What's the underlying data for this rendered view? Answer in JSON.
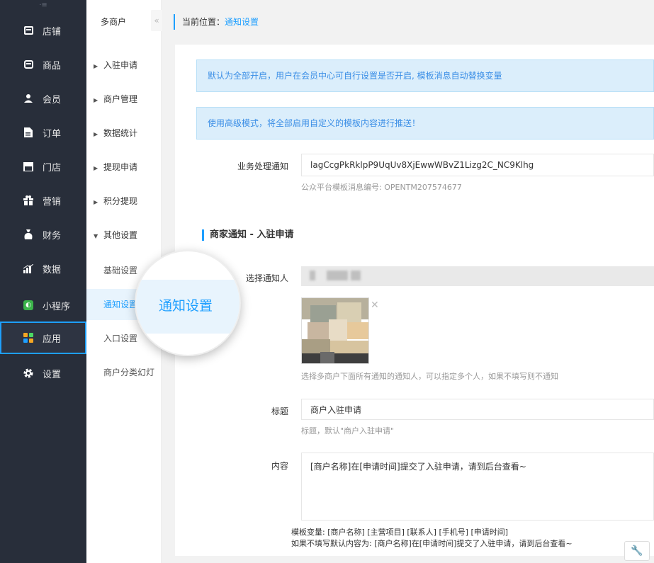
{
  "sidebar": {
    "items": [
      {
        "label": "店铺",
        "icon": "store-icon"
      },
      {
        "label": "商品",
        "icon": "goods-icon"
      },
      {
        "label": "会员",
        "icon": "user-icon"
      },
      {
        "label": "订单",
        "icon": "order-icon"
      },
      {
        "label": "门店",
        "icon": "shop-icon"
      },
      {
        "label": "营销",
        "icon": "gift-icon"
      },
      {
        "label": "财务",
        "icon": "money-bag-icon"
      },
      {
        "label": "数据",
        "icon": "bar-chart-icon"
      },
      {
        "label": "小程序",
        "icon": "mini-program-icon"
      },
      {
        "label": "应用",
        "icon": "apps-icon"
      },
      {
        "label": "设置",
        "icon": "gear-icon"
      }
    ]
  },
  "submenu": {
    "title": "多商户",
    "items": [
      "入驻申请",
      "商户管理",
      "数据统计",
      "提现申请",
      "积分提现",
      "其他设置"
    ],
    "subitems": [
      "基础设置",
      "通知设置",
      "入口设置",
      "商户分类幻灯"
    ]
  },
  "breadcrumb": {
    "prefix": "当前位置：",
    "current": "通知设置"
  },
  "tips": {
    "tip1": "默认为全部开启，用户在会员中心可自行设置是否开启, 模板消息自动替换变量",
    "tip2": "使用高级模式，将全部启用自定义的模板内容进行推送！"
  },
  "business_notice": {
    "label": "业务处理通知",
    "value": "lagCcgPkRklpP9UqUv8XjEwwWBvZ1Lizg2C_NC9Klhg",
    "help": "公众平台模板消息编号: OPENTM207574677"
  },
  "section": {
    "title": "商家通知 - 入驻申请"
  },
  "notify_person": {
    "label": "选择通知人",
    "help": "选择多商户下面所有通知的通知人，可以指定多个人，如果不填写则不通知"
  },
  "title_field": {
    "label": "标题",
    "value": "商户入驻申请",
    "help": "标题，默认\"商户入驻申请\""
  },
  "content_field": {
    "label": "内容",
    "value": "[商户名称]在[申请时间]提交了入驻申请，请到后台查看~",
    "vars": "模板变量: [商户名称] [主营项目] [联系人] [手机号] [申请时间]",
    "default": "如果不填写默认内容为: [商户名称]在[申请时间]提交了入驻申请，请到后台查看~"
  },
  "magnifier": {
    "label": "通知设置"
  },
  "colors": {
    "accent": "#1e9fff",
    "sidebar_bg": "#282e3a",
    "tip_bg": "#dbeefb"
  }
}
